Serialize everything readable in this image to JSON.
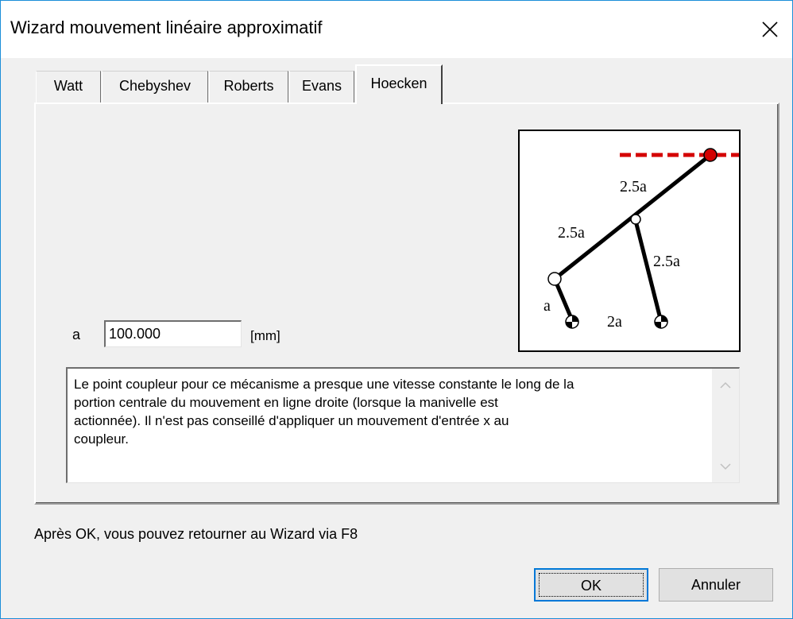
{
  "window": {
    "title": "Wizard mouvement linéaire approximatif"
  },
  "tabs": [
    {
      "label": "Watt",
      "active": false
    },
    {
      "label": "Chebyshev",
      "active": false
    },
    {
      "label": "Roberts",
      "active": false
    },
    {
      "label": "Evans",
      "active": false
    },
    {
      "label": "Hoecken",
      "active": true
    }
  ],
  "diagram": {
    "labels": {
      "coupler_upper": "2.5a",
      "coupler_lower": "2.5a",
      "rocker": "2.5a",
      "crank": "a",
      "ground": "2a"
    },
    "colors": {
      "path": "#d40000",
      "coupler_point": "#d40000",
      "links": "#000000"
    }
  },
  "parameter": {
    "label": "a",
    "value": "100.000",
    "unit": "[mm]"
  },
  "description": "Le point coupleur pour ce mécanisme a presque une vitesse constante le long de la\nportion centrale du mouvement en ligne droite (lorsque la manivelle est\nactionnée). Il n'est pas conseillé d'appliquer un mouvement d'entrée x au\ncoupleur.",
  "footer_note": "Après OK, vous pouvez retourner au Wizard via F8",
  "buttons": {
    "ok": "OK",
    "cancel": "Annuler"
  }
}
